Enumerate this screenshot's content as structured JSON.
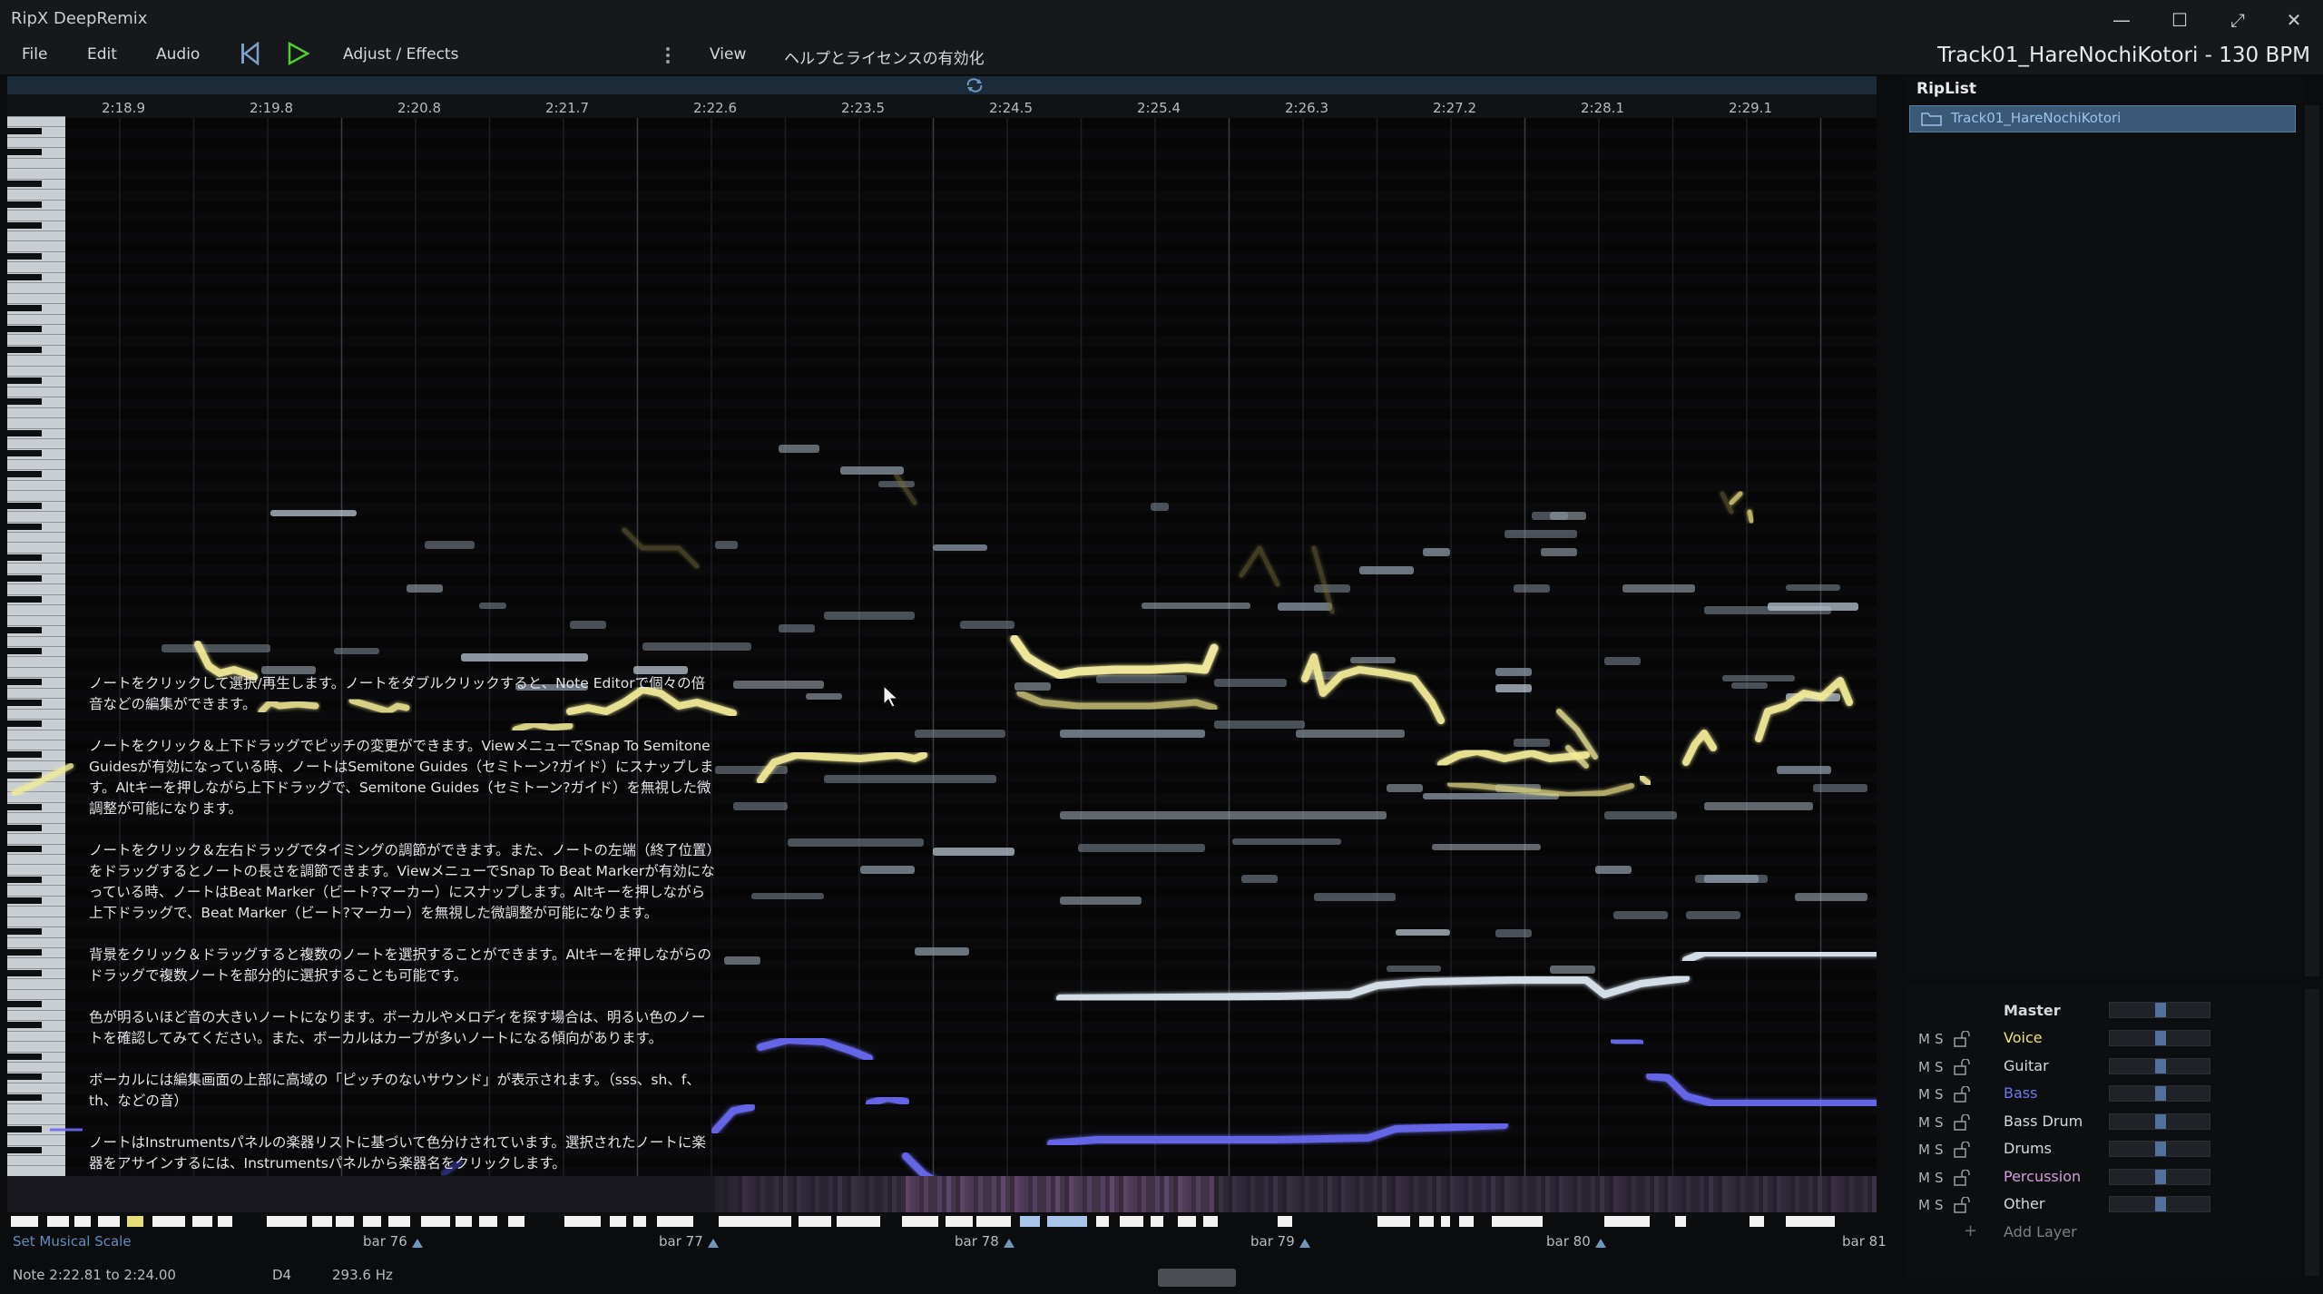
{
  "app": {
    "title": "RipX DeepRemix"
  },
  "window_controls": [
    "—",
    "☐",
    "⤢",
    "✕"
  ],
  "menu": {
    "file": "File",
    "edit": "Edit",
    "audio": "Audio",
    "adjust": "Adjust / Effects",
    "view": "View",
    "help_license": "ヘルプとライセンスの有効化"
  },
  "song": {
    "title": "Track01_HareNochiKotori - 130 BPM"
  },
  "ruler": {
    "times": [
      "2:18.9",
      "2:19.8",
      "2:20.8",
      "2:21.7",
      "2:22.6",
      "2:23.5",
      "2:24.5",
      "2:25.4",
      "2:26.3",
      "2:27.2",
      "2:28.1",
      "2:29.1"
    ]
  },
  "bars": {
    "labels": [
      "bar 76",
      "bar 77",
      "bar 78",
      "bar 79",
      "bar 80",
      "bar 81"
    ]
  },
  "status": {
    "set_scale": "Set Musical Scale",
    "note_range": "Note 2:22.81 to 2:24.00",
    "pitch": "D4",
    "frequency": "293.6 Hz"
  },
  "help": {
    "p1": "ノートをクリックして選択/再生します。ノートをダブルクリックすると、Note Editorで個々の倍音などの編集ができます。",
    "p2": "ノートをクリック＆上下ドラッグでピッチの変更ができます。ViewメニューでSnap To Semitone Guidesが有効になっている時、ノートはSemitone Guides（セミトーン?ガイド）にスナップします。Altキーを押しながら上下ドラッグで、Semitone Guides（セミトーン?ガイド）を無視した微調整が可能になります。",
    "p3": "ノートをクリック＆左右ドラッグでタイミングの調節ができます。また、ノートの左端（終了位置）をドラッグするとノートの長さを調節できます。ViewメニューでSnap To Beat Markerが有効になっている時、ノートはBeat Marker（ビート?マーカー）にスナップします。Altキーを押しながら上下ドラッグで、Beat Marker（ビート?マーカー）を無視した微調整が可能になります。",
    "p4": "背景をクリック＆ドラッグすると複数のノートを選択することができます。Altキーを押しながらのドラッグで複数ノートを部分的に選択することも可能です。",
    "p5": "色が明るいほど音の大きいノートになります。ボーカルやメロディを探す場合は、明るい色のノートを確認してみてください。また、ボーカルはカーブが多いノートになる傾向があります。",
    "p6": "ボーカルには編集画面の上部に高域の「ピッチのないサウンド」が表示されます。（sss、sh、f、th、などの音）",
    "p7": "ノートはInstrumentsパネルの楽器リストに基づいて色分けされています。選択されたノートに楽器をアサインするには、Instrumentsパネルから楽器名をクリックします。"
  },
  "riplist": {
    "title": "RipList",
    "item": "Track01_HareNochiKotori"
  },
  "mixer": {
    "master": "Master",
    "m": "M",
    "s": "S",
    "layers": [
      {
        "name": "Voice",
        "color": "#f0e46a"
      },
      {
        "name": "Guitar",
        "color": "#d6d8dc"
      },
      {
        "name": "Bass",
        "color": "#6f78f0"
      },
      {
        "name": "Bass Drum",
        "color": "#d6d8dc"
      },
      {
        "name": "Drums",
        "color": "#d6d8dc"
      },
      {
        "name": "Percussion",
        "color": "#d59ee0"
      },
      {
        "name": "Other",
        "color": "#d6d8dc"
      }
    ],
    "add_layer": "Add Layer"
  },
  "colors": {
    "voice": "#f3ec98",
    "bass": "#5c5cf0",
    "other": "#9bb0c4",
    "accent": "#3b5876"
  }
}
